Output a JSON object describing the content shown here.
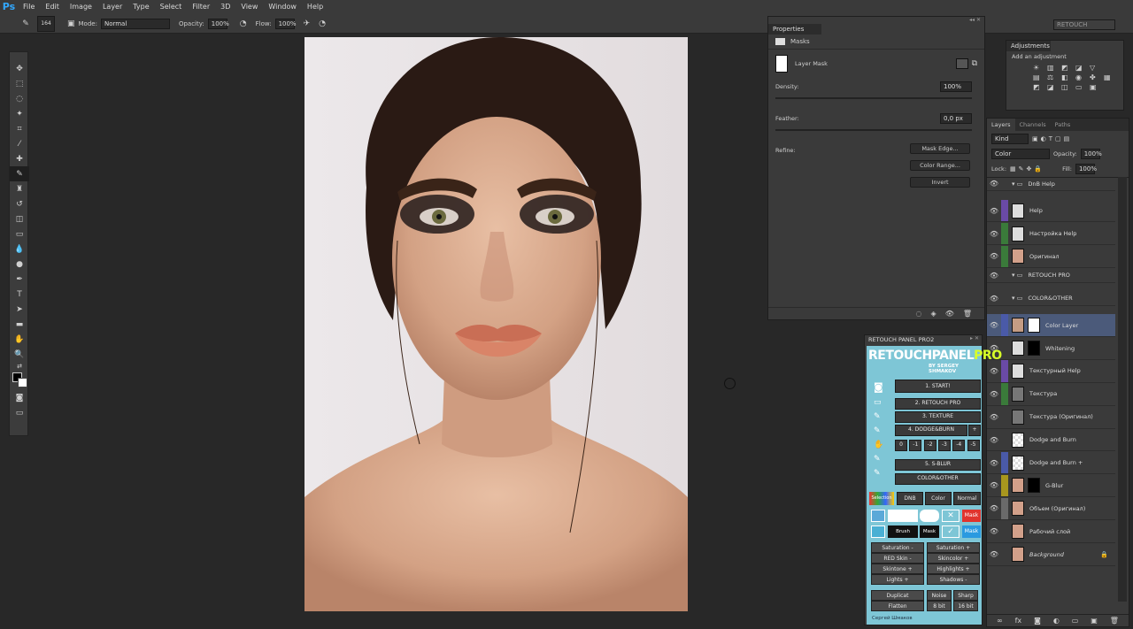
{
  "app": {
    "logo": "Ps"
  },
  "menu": [
    "File",
    "Edit",
    "Image",
    "Layer",
    "Type",
    "Select",
    "Filter",
    "3D",
    "View",
    "Window",
    "Help"
  ],
  "options": {
    "brush_size": "164",
    "mode_label": "Mode:",
    "mode_value": "Normal",
    "opacity_label": "Opacity:",
    "opacity_value": "100%",
    "flow_label": "Flow:",
    "flow_value": "100%",
    "workspace": "RETOUCH"
  },
  "properties": {
    "title": "Properties",
    "section": "Masks",
    "mask_label": "Layer Mask",
    "density_label": "Density:",
    "density_value": "100%",
    "feather_label": "Feather:",
    "feather_value": "0,0 px",
    "refine_label": "Refine:",
    "buttons": [
      "Mask Edge...",
      "Color Range...",
      "Invert"
    ]
  },
  "adjustments": {
    "tab": "Adjustments",
    "subtitle": "Add an adjustment"
  },
  "layers_panel": {
    "tabs": [
      "Layers",
      "Channels",
      "Paths"
    ],
    "filter_value": "Kind",
    "blend_value": "Color",
    "opacity_label": "Opacity:",
    "opacity_value": "100%",
    "lock_label": "Lock:",
    "fill_label": "Fill:",
    "fill_value": "100%",
    "layers": [
      {
        "name": "DnB Help",
        "color": "",
        "type": "group"
      },
      {
        "name": "Help",
        "color": "#6a4aa6",
        "type": "adj"
      },
      {
        "name": "Настройка Help",
        "color": "#3a7a3a",
        "type": "adj"
      },
      {
        "name": "Оригинал",
        "color": "#3a7a3a",
        "type": "face"
      },
      {
        "name": "RETOUCH PRO",
        "color": "",
        "type": "group"
      },
      {
        "name": "COLOR&OTHER",
        "color": "",
        "type": "group"
      },
      {
        "name": "Color Layer",
        "color": "#4a5aa8",
        "type": "mask"
      },
      {
        "name": "Whitening",
        "color": "",
        "type": "adj"
      },
      {
        "name": "Текстурный Help",
        "color": "#6a4aa6",
        "type": "adj"
      },
      {
        "name": "Текстура",
        "color": "#3a7a3a",
        "type": "gray"
      },
      {
        "name": "Текстура (Оригинал)",
        "color": "",
        "type": "gray"
      },
      {
        "name": "Dodge and Burn",
        "color": "",
        "type": "trans"
      },
      {
        "name": "Dodge and Burn +",
        "color": "#4a5aa8",
        "type": "trans"
      },
      {
        "name": "G-Blur",
        "color": "#a8961e",
        "type": "face"
      },
      {
        "name": "Объем (Оригинал)",
        "color": "#6a6a6a",
        "type": "face"
      },
      {
        "name": "Рабочий слой",
        "color": "",
        "type": "face"
      },
      {
        "name": "Background",
        "color": "",
        "type": "face"
      }
    ]
  },
  "retouch_panel": {
    "title": "RETOUCH PANEL PRO2",
    "logo_a": "RETOUCH",
    "logo_b": "PANEL",
    "logo_c": "PRO",
    "by": "BY SERGEY SHMAKOV",
    "start": "1. START!",
    "b2": "2. RETOUCH PRO",
    "b3": "3. TEXTURE",
    "b4": "4. DODGE&BURN",
    "plus": "+",
    "nums": [
      "0",
      "-1",
      "-2",
      "-3",
      "-4",
      "-5"
    ],
    "b5": "5. S-BLUR",
    "b6": "COLOR&OTHER",
    "sel_label": "Selection",
    "dnb": "DNB",
    "color": "Color",
    "normal": "Normal",
    "brush_label": "Brush",
    "mask_label": "Mask",
    "adjust": [
      "Saturation -",
      "Saturation +",
      "RED Skin -",
      "Skincolor +",
      "Skintone +",
      "Highlights +",
      "Lights +",
      "Shadows -"
    ],
    "bottom": [
      "Duplicat",
      "Noise",
      "Sharp",
      "Flatten",
      "8 bit",
      "16 bit"
    ],
    "footer": "Сергей Шмаков"
  },
  "colors": {
    "accent": "#31a8ff",
    "panel_bg": "#3a3a3a",
    "retouch_bg": "#7ec6d6"
  }
}
